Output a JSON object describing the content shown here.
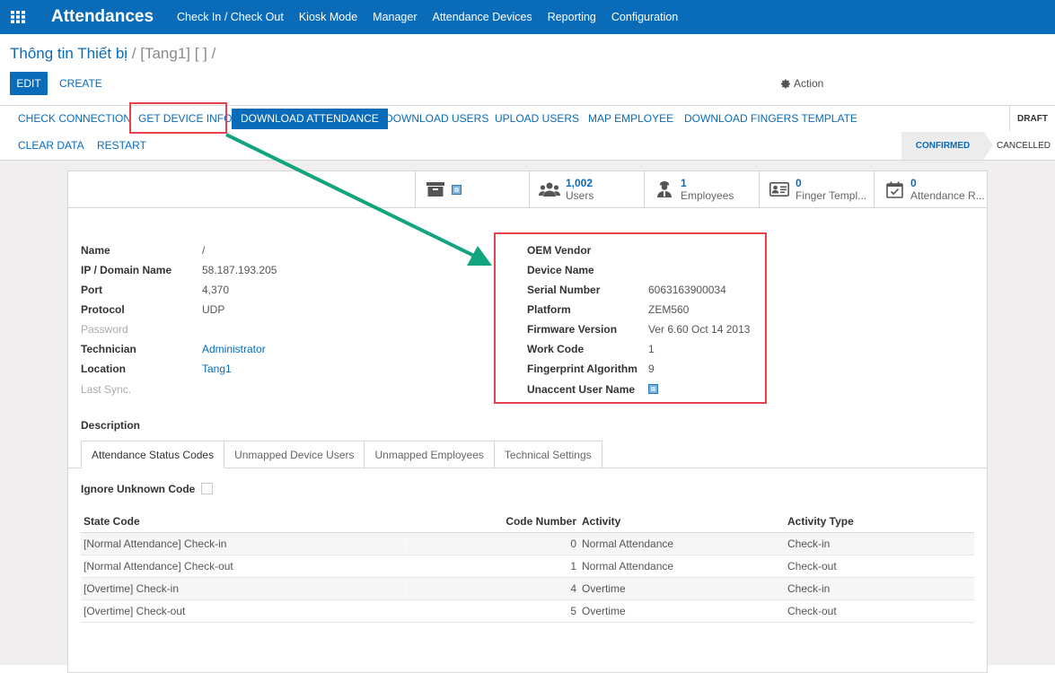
{
  "topbar": {
    "app_title": "Attendances",
    "menu": [
      "Check In / Check Out",
      "Kiosk Mode",
      "Manager",
      "Attendance Devices",
      "Reporting",
      "Configuration"
    ]
  },
  "breadcrumb": {
    "parent": "Thông tin Thiết bị",
    "sep1": "/",
    "current": "[Tang1] [ ]",
    "sep2": "/"
  },
  "control": {
    "edit": "EDIT",
    "create": "CREATE",
    "action": "Action"
  },
  "header_buttons": {
    "check_connection": "CHECK CONNECTION",
    "get_device_info": "GET DEVICE INFO",
    "download_attendance": "DOWNLOAD ATTENDANCE",
    "download_users": "DOWNLOAD USERS",
    "upload_users": "UPLOAD USERS",
    "map_employee": "MAP EMPLOYEE",
    "download_fingers_template": "DOWNLOAD FINGERS TEMPLATE",
    "clear_data": "CLEAR DATA",
    "restart": "RESTART"
  },
  "status": {
    "draft": "DRAFT",
    "confirmed": "CONFIRMED",
    "cancelled": "CANCELLED"
  },
  "smart_buttons": {
    "users": {
      "value": "1,002",
      "label": "Users"
    },
    "employees": {
      "value": "1",
      "label": "Employees"
    },
    "finger": {
      "value": "0",
      "label": "Finger Templ..."
    },
    "attendance": {
      "value": "0",
      "label": "Attendance R..."
    }
  },
  "left_fields": {
    "name": {
      "label": "Name",
      "value": "/"
    },
    "ip": {
      "label": "IP / Domain Name",
      "value": "58.187.193.205"
    },
    "port": {
      "label": "Port",
      "value": "4,370"
    },
    "protocol": {
      "label": "Protocol",
      "value": "UDP"
    },
    "password": {
      "label": "Password",
      "value": ""
    },
    "technician": {
      "label": "Technician",
      "value": "Administrator"
    },
    "location": {
      "label": "Location",
      "value": "Tang1"
    },
    "last_sync": {
      "label": "Last Sync.",
      "value": ""
    }
  },
  "right_fields": {
    "oem_vendor": {
      "label": "OEM Vendor",
      "value": ""
    },
    "device_name": {
      "label": "Device Name",
      "value": ""
    },
    "serial": {
      "label": "Serial Number",
      "value": "6063163900034"
    },
    "platform": {
      "label": "Platform",
      "value": "ZEM560"
    },
    "firmware": {
      "label": "Firmware Version",
      "value": "Ver 6.60 Oct 14 2013"
    },
    "work_code": {
      "label": "Work Code",
      "value": "1"
    },
    "fp_algorithm": {
      "label": "Fingerprint Algorithm",
      "value": "9"
    },
    "unaccent": {
      "label": "Unaccent User Name"
    }
  },
  "description_label": "Description",
  "tabs": [
    "Attendance Status Codes",
    "Unmapped Device Users",
    "Unmapped Employees",
    "Technical Settings"
  ],
  "ignore_unknown_label": "Ignore Unknown Code",
  "table": {
    "headers": [
      "State Code",
      "Code Number",
      "Activity",
      "Activity Type"
    ],
    "rows": [
      [
        "[Normal Attendance] Check-in",
        "0",
        "Normal Attendance",
        "Check-in"
      ],
      [
        "[Normal Attendance] Check-out",
        "1",
        "Normal Attendance",
        "Check-out"
      ],
      [
        "[Overtime] Check-in",
        "4",
        "Overtime",
        "Check-in"
      ],
      [
        "[Overtime] Check-out",
        "5",
        "Overtime",
        "Check-out"
      ]
    ]
  },
  "colors": {
    "brand": "#0a6bb9",
    "highlight_box": "#e4434b",
    "annotation_arrow": "#12a37f"
  }
}
